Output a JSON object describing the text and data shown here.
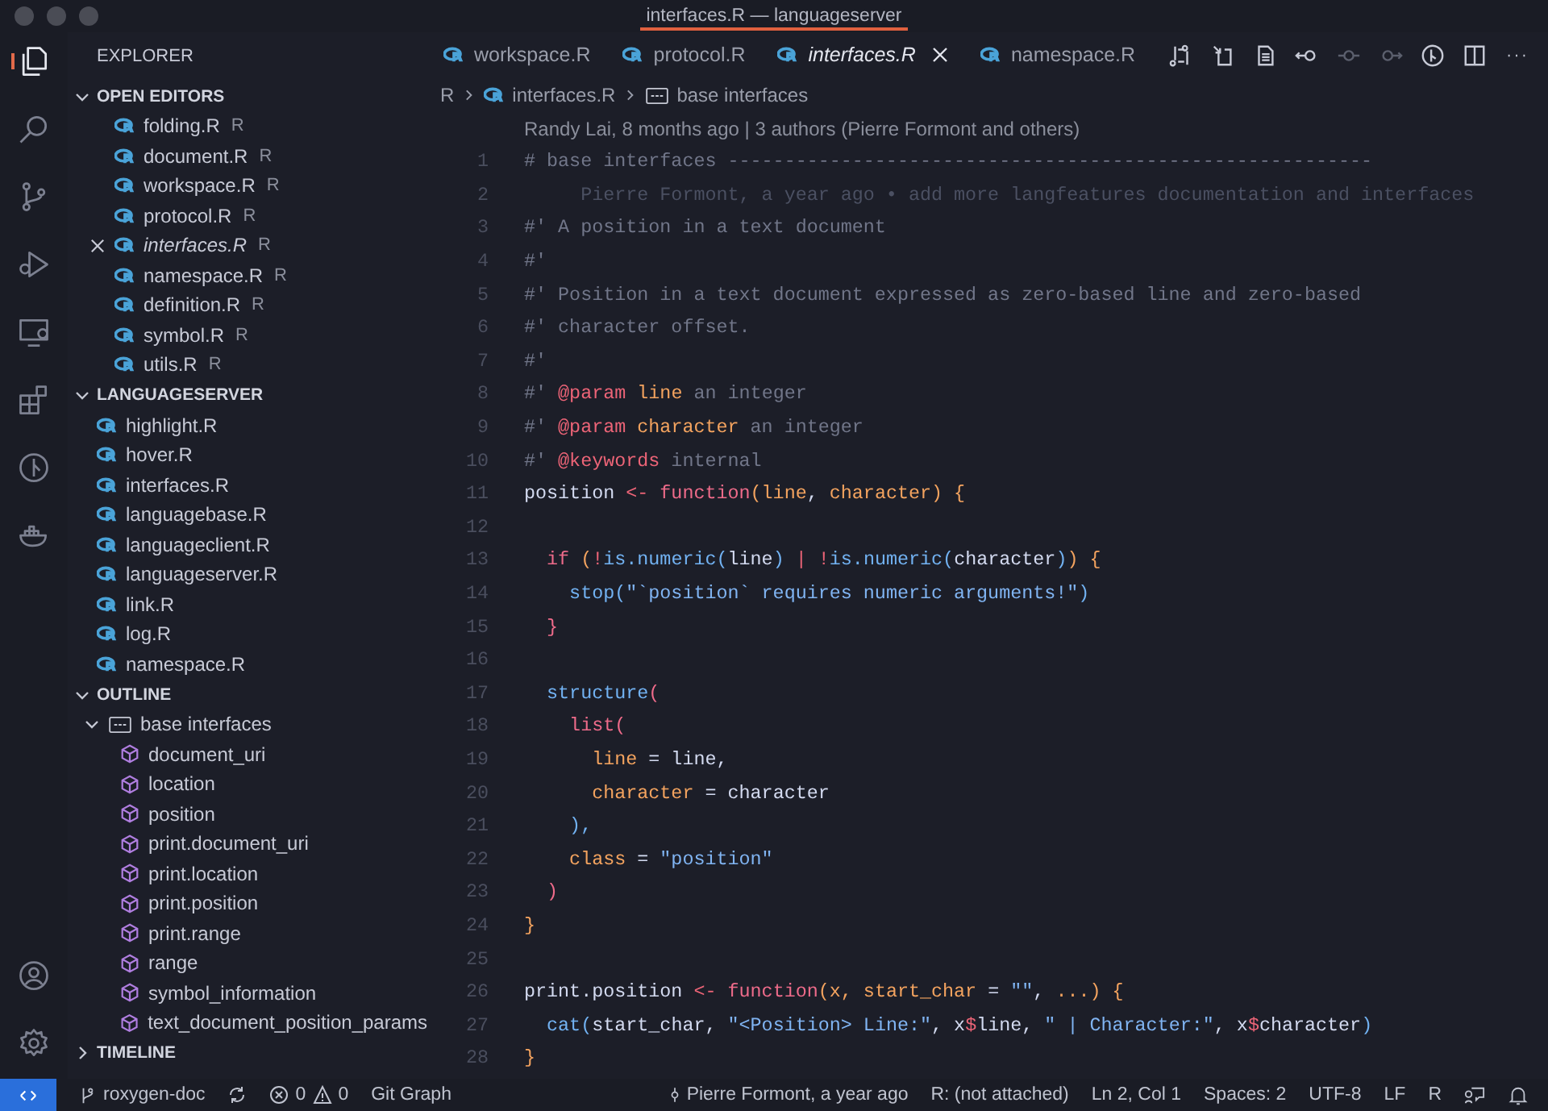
{
  "window": {
    "title": "interfaces.R — languageserver"
  },
  "sidebar": {
    "title": "EXPLORER",
    "sections": [
      {
        "kind": "open_editors",
        "title": "OPEN EDITORS",
        "expanded": true,
        "items": [
          {
            "name": "folding.R",
            "badge": "R",
            "active": false
          },
          {
            "name": "document.R",
            "badge": "R",
            "active": false
          },
          {
            "name": "workspace.R",
            "badge": "R",
            "active": false
          },
          {
            "name": "protocol.R",
            "badge": "R",
            "active": false
          },
          {
            "name": "interfaces.R",
            "badge": "R",
            "active": true
          },
          {
            "name": "namespace.R",
            "badge": "R",
            "active": false
          },
          {
            "name": "definition.R",
            "badge": "R",
            "active": false
          },
          {
            "name": "symbol.R",
            "badge": "R",
            "active": false
          },
          {
            "name": "utils.R",
            "badge": "R",
            "active": false
          }
        ]
      },
      {
        "kind": "folder",
        "title": "LANGUAGESERVER",
        "expanded": true,
        "items": [
          {
            "name": "highlight.R"
          },
          {
            "name": "hover.R"
          },
          {
            "name": "interfaces.R"
          },
          {
            "name": "languagebase.R"
          },
          {
            "name": "languageclient.R"
          },
          {
            "name": "languageserver.R"
          },
          {
            "name": "link.R"
          },
          {
            "name": "log.R"
          },
          {
            "name": "namespace.R"
          }
        ]
      },
      {
        "kind": "outline",
        "title": "OUTLINE",
        "expanded": true,
        "items": [
          {
            "label": "base interfaces",
            "expanded": true,
            "children": [
              {
                "label": "document_uri"
              },
              {
                "label": "location"
              },
              {
                "label": "position"
              },
              {
                "label": "print.document_uri"
              },
              {
                "label": "print.location"
              },
              {
                "label": "print.position"
              },
              {
                "label": "print.range"
              },
              {
                "label": "range"
              },
              {
                "label": "symbol_information"
              },
              {
                "label": "text_document_position_params"
              }
            ]
          }
        ]
      },
      {
        "kind": "timeline",
        "title": "TIMELINE",
        "expanded": false
      }
    ]
  },
  "editor": {
    "tabs": [
      {
        "label": "workspace.R",
        "selected": false
      },
      {
        "label": "protocol.R",
        "selected": false
      },
      {
        "label": "interfaces.R",
        "selected": true
      },
      {
        "label": "namespace.R",
        "selected": false
      }
    ],
    "breadcrumbs": [
      {
        "kind": "folder",
        "label": "R"
      },
      {
        "kind": "file",
        "label": "interfaces.R"
      },
      {
        "kind": "symbol",
        "label": "base interfaces"
      }
    ],
    "blame_header": "Randy Lai, 8 months ago | 3 authors (Pierre Formont and others)",
    "lines": [
      {
        "number": "1",
        "tokens": [
          {
            "kind": "comment",
            "text": "# base interfaces ---------------------------------------------------------"
          }
        ]
      },
      {
        "number": "2",
        "tokens": [
          {
            "kind": "blame",
            "text": "     Pierre Formont, a year ago • add more langfeatures documentation and interfaces"
          }
        ]
      },
      {
        "number": "3",
        "tokens": [
          {
            "kind": "comment",
            "text": "#' A position in a text document"
          }
        ]
      },
      {
        "number": "4",
        "tokens": [
          {
            "kind": "comment",
            "text": "#'"
          }
        ]
      },
      {
        "number": "5",
        "tokens": [
          {
            "kind": "comment",
            "text": "#' Position in a text document expressed as zero-based line and zero-based"
          }
        ]
      },
      {
        "number": "6",
        "tokens": [
          {
            "kind": "comment",
            "text": "#' character offset."
          }
        ]
      },
      {
        "number": "7",
        "tokens": [
          {
            "kind": "comment",
            "text": "#'"
          }
        ]
      },
      {
        "number": "8",
        "tokens": [
          {
            "kind": "comment",
            "text": "#' "
          },
          {
            "kind": "tag",
            "text": "@param"
          },
          {
            "kind": "argname",
            "text": " line"
          },
          {
            "kind": "comment",
            "text": " an integer"
          }
        ]
      },
      {
        "number": "9",
        "tokens": [
          {
            "kind": "comment",
            "text": "#' "
          },
          {
            "kind": "tag",
            "text": "@param"
          },
          {
            "kind": "argname",
            "text": " character"
          },
          {
            "kind": "comment",
            "text": " an integer"
          }
        ]
      },
      {
        "number": "10",
        "tokens": [
          {
            "kind": "comment",
            "text": "#' "
          },
          {
            "kind": "tag",
            "text": "@keywords"
          },
          {
            "kind": "comment",
            "text": " internal"
          }
        ]
      },
      {
        "number": "11",
        "tokens": [
          {
            "kind": "ident",
            "text": "position"
          },
          {
            "kind": "op",
            "text": " <- "
          },
          {
            "kind": "keyword",
            "text": "function"
          },
          {
            "kind": "punct",
            "text": "("
          },
          {
            "kind": "argname",
            "text": "line"
          },
          {
            "kind": "plain",
            "text": ", "
          },
          {
            "kind": "argname",
            "text": "character"
          },
          {
            "kind": "punct",
            "text": ") {"
          }
        ]
      },
      {
        "number": "12"
      },
      {
        "number": "13",
        "tokens": [
          {
            "kind": "keyword",
            "text": "  if"
          },
          {
            "kind": "punct",
            "text": " ("
          },
          {
            "kind": "op",
            "text": "!"
          },
          {
            "kind": "call",
            "text": "is.numeric("
          },
          {
            "kind": "ident",
            "text": "line"
          },
          {
            "kind": "call",
            "text": ")"
          },
          {
            "kind": "op",
            "text": " | !"
          },
          {
            "kind": "call",
            "text": "is.numeric("
          },
          {
            "kind": "ident",
            "text": "character"
          },
          {
            "kind": "call",
            "text": ")"
          },
          {
            "kind": "punct",
            "text": ") {"
          }
        ]
      },
      {
        "number": "14",
        "tokens": [
          {
            "kind": "call",
            "text": "    stop("
          },
          {
            "kind": "string",
            "text": "\"`position` requires numeric arguments!\""
          },
          {
            "kind": "call",
            "text": ")"
          }
        ]
      },
      {
        "number": "15",
        "tokens": [
          {
            "kind": "keyword",
            "text": "  }"
          }
        ]
      },
      {
        "number": "16"
      },
      {
        "number": "17",
        "tokens": [
          {
            "kind": "call",
            "text": "  structure"
          },
          {
            "kind": "keyword",
            "text": "("
          }
        ]
      },
      {
        "number": "18",
        "tokens": [
          {
            "kind": "keyword",
            "text": "    list("
          }
        ]
      },
      {
        "number": "19",
        "tokens": [
          {
            "kind": "argname",
            "text": "      line"
          },
          {
            "kind": "plain",
            "text": " = line,"
          }
        ]
      },
      {
        "number": "20",
        "tokens": [
          {
            "kind": "argname",
            "text": "      character"
          },
          {
            "kind": "plain",
            "text": " = character"
          }
        ]
      },
      {
        "number": "21",
        "tokens": [
          {
            "kind": "call",
            "text": "    ),"
          }
        ]
      },
      {
        "number": "22",
        "tokens": [
          {
            "kind": "argname",
            "text": "    class"
          },
          {
            "kind": "plain",
            "text": " = "
          },
          {
            "kind": "string",
            "text": "\"position\""
          }
        ]
      },
      {
        "number": "23",
        "tokens": [
          {
            "kind": "keyword",
            "text": "  )"
          }
        ]
      },
      {
        "number": "24",
        "tokens": [
          {
            "kind": "punct",
            "text": "}"
          }
        ]
      },
      {
        "number": "25"
      },
      {
        "number": "26",
        "tokens": [
          {
            "kind": "ident",
            "text": "print.position"
          },
          {
            "kind": "op",
            "text": " <- "
          },
          {
            "kind": "keyword",
            "text": "function"
          },
          {
            "kind": "punct",
            "text": "("
          },
          {
            "kind": "argname",
            "text": "x, start_char"
          },
          {
            "kind": "plain",
            "text": " = "
          },
          {
            "kind": "string",
            "text": "\"\""
          },
          {
            "kind": "plain",
            "text": ", "
          },
          {
            "kind": "argname",
            "text": "..."
          },
          {
            "kind": "punct",
            "text": ") {"
          }
        ]
      },
      {
        "number": "27",
        "tokens": [
          {
            "kind": "call",
            "text": "  cat("
          },
          {
            "kind": "plain",
            "text": "start_char, "
          },
          {
            "kind": "string",
            "text": "\"<Position> Line:\""
          },
          {
            "kind": "plain",
            "text": ", x"
          },
          {
            "kind": "op",
            "text": "$"
          },
          {
            "kind": "plain",
            "text": "line, "
          },
          {
            "kind": "string",
            "text": "\" | Character:\""
          },
          {
            "kind": "plain",
            "text": ", x"
          },
          {
            "kind": "op",
            "text": "$"
          },
          {
            "kind": "plain",
            "text": "character"
          },
          {
            "kind": "call",
            "text": ")"
          }
        ]
      },
      {
        "number": "28",
        "tokens": [
          {
            "kind": "punct",
            "text": "}"
          }
        ]
      }
    ]
  },
  "status_bar": {
    "branch": "roxygen-doc",
    "errors": "0",
    "warnings": "0",
    "git_graph": "Git Graph",
    "blame": "Pierre Formont, a year ago",
    "r_session": "R: (not attached)",
    "cursor": "Ln 2, Col 1",
    "indent": "Spaces: 2",
    "encoding": "UTF-8",
    "eol": "LF",
    "language": "R"
  }
}
